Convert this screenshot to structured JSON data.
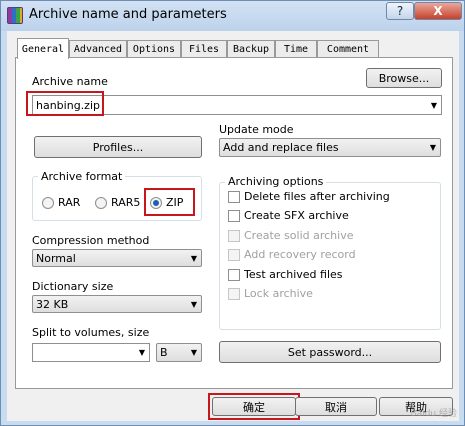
{
  "window": {
    "title": "Archive name and parameters",
    "help_glyph": "?",
    "close_glyph": "X"
  },
  "tabs": [
    "General",
    "Advanced",
    "Options",
    "Files",
    "Backup",
    "Time",
    "Comment"
  ],
  "archive_name": {
    "label": "Archive name",
    "value": "hanbing.zip",
    "browse": "Browse..."
  },
  "profiles_button": "Profiles...",
  "update_mode": {
    "label": "Update mode",
    "value": "Add and replace files"
  },
  "archive_format": {
    "title": "Archive format",
    "options": [
      "RAR",
      "RAR5",
      "ZIP"
    ],
    "selected": "ZIP"
  },
  "compression": {
    "label": "Compression method",
    "value": "Normal"
  },
  "dictionary": {
    "label": "Dictionary size",
    "value": "32 KB"
  },
  "split": {
    "label": "Split to volumes, size",
    "value": "",
    "unit": "B"
  },
  "archiving_options": {
    "title": "Archiving options",
    "items": [
      {
        "label": "Delete files after archiving",
        "checked": false,
        "enabled": true
      },
      {
        "label": "Create SFX archive",
        "checked": false,
        "enabled": true
      },
      {
        "label": "Create solid archive",
        "checked": false,
        "enabled": false
      },
      {
        "label": "Add recovery record",
        "checked": false,
        "enabled": false
      },
      {
        "label": "Test archived files",
        "checked": false,
        "enabled": true
      },
      {
        "label": "Lock archive",
        "checked": false,
        "enabled": false
      }
    ]
  },
  "set_password": "Set password...",
  "buttons": {
    "ok": "确定",
    "cancel": "取消",
    "help": "帮助"
  },
  "watermark": "Baidu 经验",
  "accent_colors": {
    "highlight_box": "#c8161d"
  }
}
